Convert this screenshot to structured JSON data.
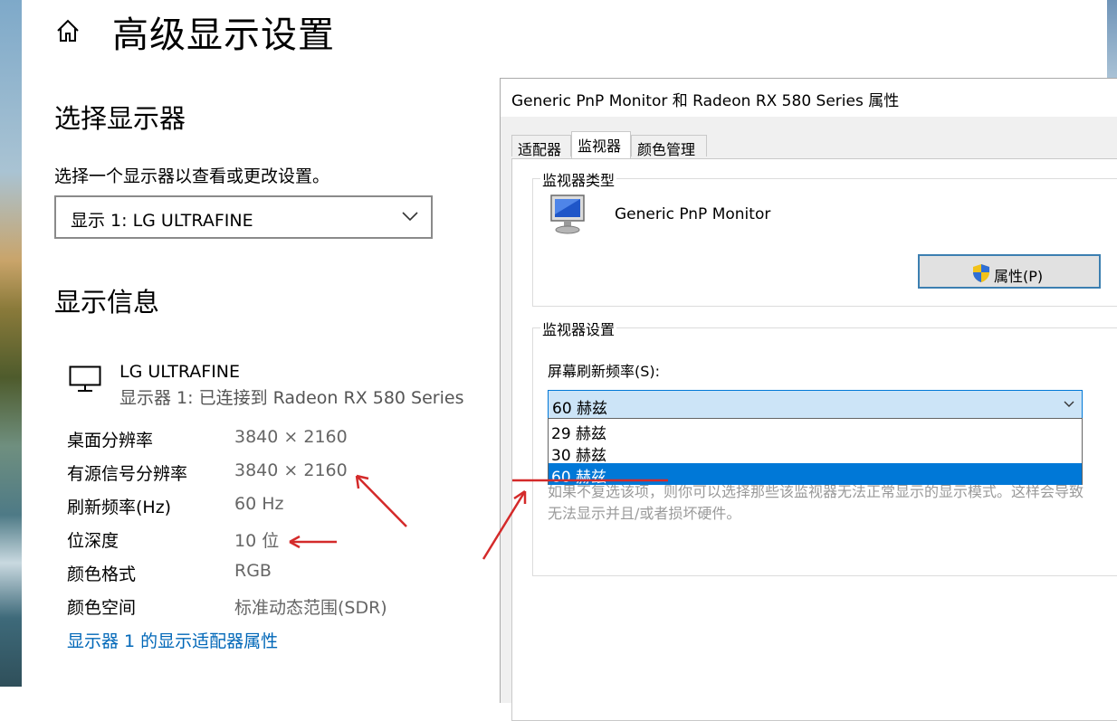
{
  "settings": {
    "title": "高级显示设置",
    "select_display": {
      "heading": "选择显示器",
      "description": "选择一个显示器以查看或更改设置。",
      "selected": "显示 1: LG ULTRAFINE"
    },
    "display_info": {
      "heading": "显示信息",
      "monitor_name": "LG ULTRAFINE",
      "monitor_sub": "显示器 1: 已连接到 Radeon RX 580 Series",
      "rows": [
        {
          "key": "桌面分辨率",
          "value": "3840 × 2160"
        },
        {
          "key": "有源信号分辨率",
          "value": "3840 × 2160"
        },
        {
          "key": "刷新频率(Hz)",
          "value": "60 Hz"
        },
        {
          "key": "位深度",
          "value": "10 位"
        },
        {
          "key": "颜色格式",
          "value": "RGB"
        },
        {
          "key": "颜色空间",
          "value": "标准动态范围(SDR)"
        }
      ],
      "adapter_link": "显示器 1 的显示适配器属性"
    }
  },
  "dialog": {
    "title": "Generic PnP Monitor 和 Radeon RX 580 Series 属性",
    "tabs": [
      {
        "label": "适配器",
        "active": false
      },
      {
        "label": "监视器",
        "active": true
      },
      {
        "label": "颜色管理",
        "active": false
      }
    ],
    "monitor_type": {
      "group_label": "监视器类型",
      "name": "Generic PnP Monitor",
      "properties_button": "属性(P)"
    },
    "monitor_settings": {
      "group_label": "监视器设置",
      "refresh_label": "屏幕刷新频率(S):",
      "refresh_selected": "60 赫兹",
      "refresh_options": [
        "29 赫兹",
        "30 赫兹",
        "60 赫兹"
      ],
      "warning": "如果不复选该项，则你可以选择那些该监视器无法正常显示的显示模式。这样会导致无法显示并且/或者损坏硬件。"
    }
  },
  "colors": {
    "accent": "#0078d7",
    "link": "#0067b8",
    "annotation_arrow": "#d42a2a"
  }
}
